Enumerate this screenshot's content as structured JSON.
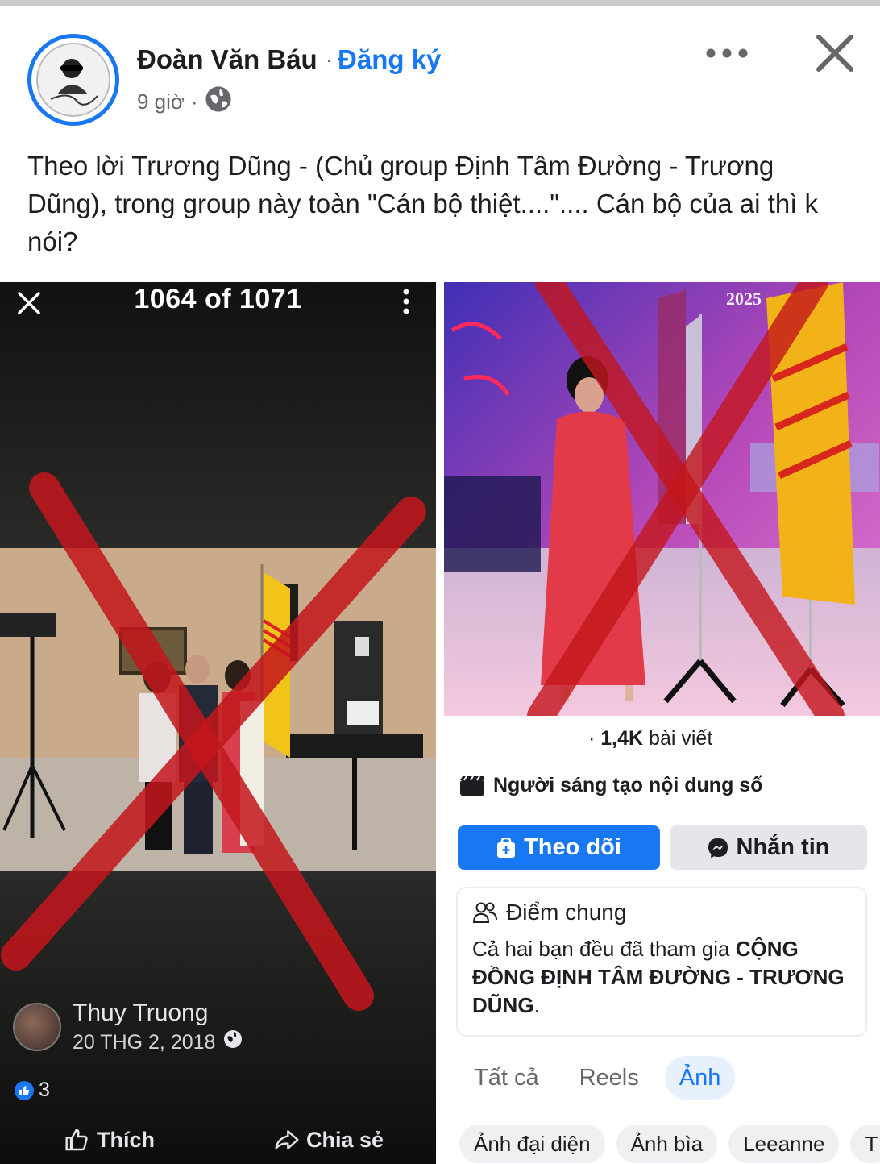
{
  "post": {
    "author_name": "Đoàn Văn Báu",
    "subscribe_label": "Đăng ký",
    "separator": "·",
    "time_ago": "9 giờ",
    "more_icon": "more-horizontal-icon",
    "close_icon": "close-icon",
    "text": "Theo lời Trương Dũng - (Chủ group Định Tâm Đường - Trương Dũng), trong group này toàn \"Cán bộ thiệt....\".... Cán bộ của ai thì k nói?"
  },
  "left_screenshot": {
    "counter": "1064 of 1071",
    "user_name": "Thuy Truong",
    "date": "20 THG 2, 2018",
    "reaction_count": "3",
    "like_label": "Thích",
    "share_label": "Chia sẻ"
  },
  "right_screenshot": {
    "photo_text": "2025",
    "posts_count": "1,4K",
    "posts_label": "bài viết",
    "creator_label": "Người sáng tạo nội dung số",
    "follow_label": "Theo dõi",
    "message_label": "Nhắn tin",
    "mutual": {
      "title": "Điểm chung",
      "text_prefix": "Cả hai bạn đều đã tham gia ",
      "group_name": "CỘNG ĐỒNG ĐỊNH TÂM ĐƯỜNG - TRƯƠNG DŨNG",
      "text_suffix": "."
    },
    "tabs": [
      "Tất cả",
      "Reels",
      "Ảnh"
    ],
    "active_tab": "Ảnh",
    "chips": [
      "Ảnh đại diện",
      "Ảnh bìa",
      "Leeanne",
      "T"
    ]
  },
  "colors": {
    "brand_blue": "#1877f2",
    "cross_red": "#c4161c"
  }
}
